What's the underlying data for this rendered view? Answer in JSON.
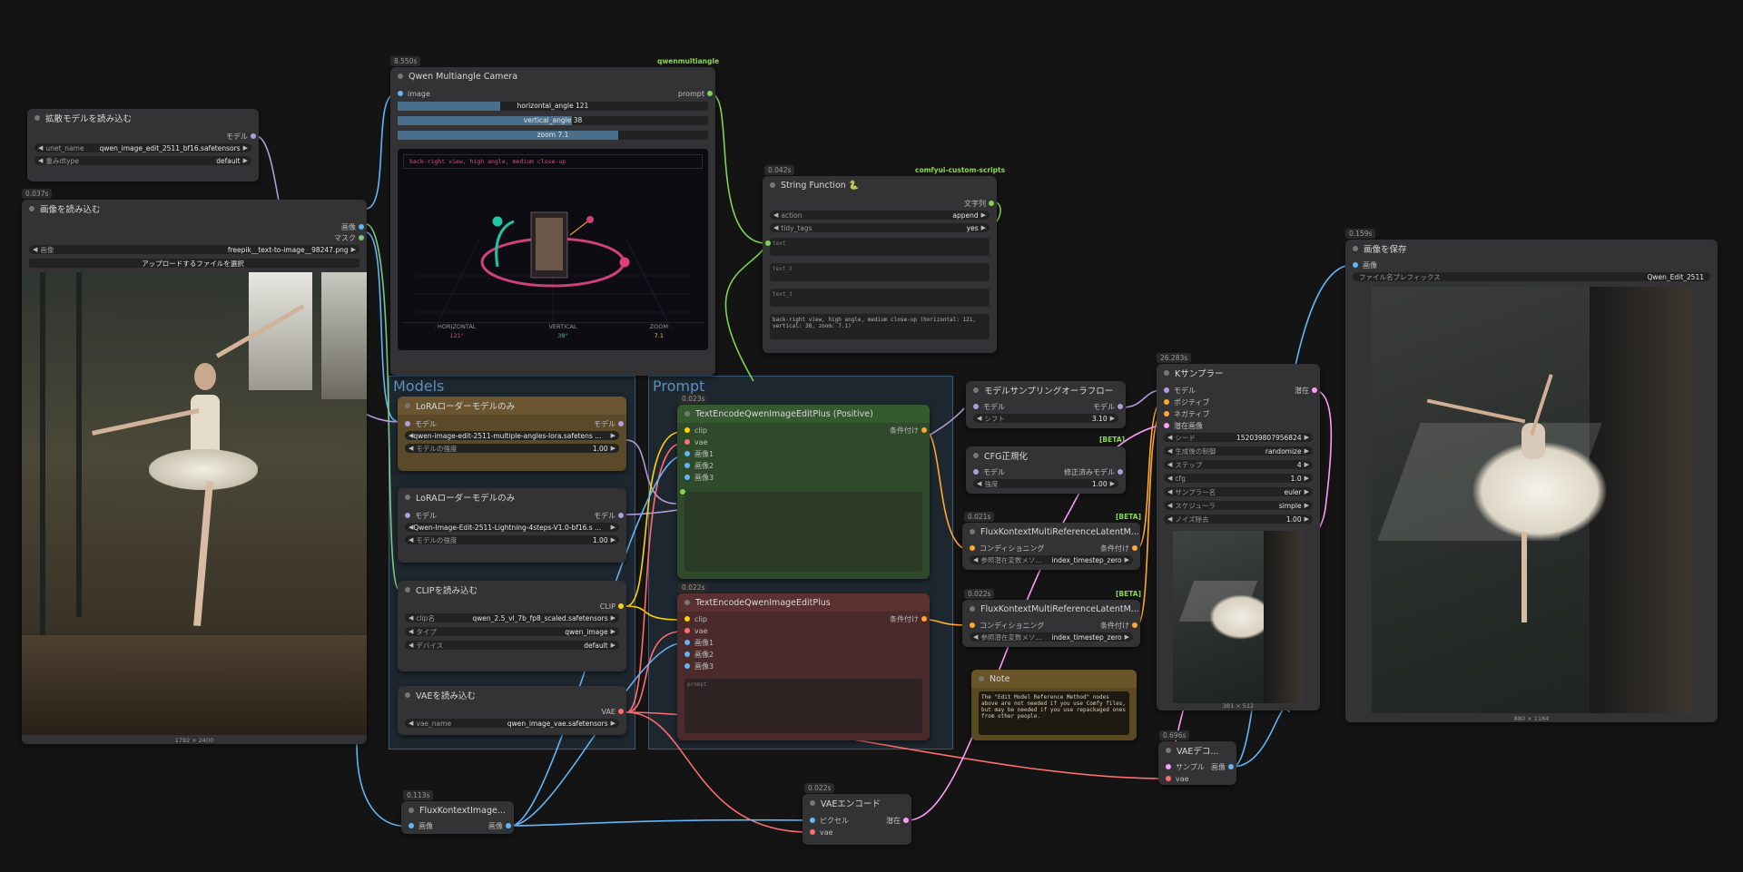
{
  "colors": {
    "image": "#64b5f6",
    "model": "#b39ddb",
    "clip": "#ffd500",
    "vae": "#ff6e6e",
    "cond": "#ffa931",
    "latent": "#ff9cf9",
    "string": "#7fd357",
    "mask": "#81c784"
  },
  "groups": {
    "models": "Models",
    "prompt": "Prompt"
  },
  "n_camera": {
    "time": "8.550s",
    "pack": "qwenmultiangle",
    "title": "Qwen Multiangle Camera",
    "in_image": "image",
    "out_prompt": "prompt",
    "h_label": "horizontal_angle",
    "h_value": "121",
    "h_fraction": 0.33,
    "v_label": "vertical_angle",
    "v_value": "38",
    "v_fraction": 0.56,
    "z_label": "zoom",
    "z_value": "7.1",
    "z_fraction": 0.71,
    "preview_text": "back-right view, high angle, medium close-up",
    "readout_h_label": "HORIZONTAL",
    "readout_h": "121°",
    "readout_v_label": "VERTICAL",
    "readout_v": "38°",
    "readout_z_label": "ZOOM",
    "readout_z": "7.1"
  },
  "n_unet": {
    "title": "拡散モデルを読み込む",
    "out": "モデル",
    "w1_label": "unet_name",
    "w1_value": "qwen_image_edit_2511_bf16.safetensors",
    "w2_label": "重みdtype",
    "w2_value": "default"
  },
  "n_loadimg": {
    "time": "0.037s",
    "title": "画像を読み込む",
    "out1": "画像",
    "out2": "マスク",
    "w1_label": "画像",
    "w1_value": "freepik__text-to-image__98247.png",
    "upload": "アップロードするファイルを選択",
    "dims": "1792 × 2400"
  },
  "n_string": {
    "time": "0.042s",
    "pack": "comfyui-custom-scripts",
    "title": "String Function 🐍",
    "out": "文字列",
    "w1_label": "action",
    "w1_value": "append",
    "w2_label": "tidy_tags",
    "w2_value": "yes",
    "t1": "text",
    "t2": "text_2",
    "t3": "text_3",
    "result": "back-right view, high angle, medium close-up (horizontal: 121, vertical: 38, zoom: 7.1)"
  },
  "n_save": {
    "time": "0.159s",
    "title": "画像を保存",
    "in": "画像",
    "w1_label": "ファイル名プレフィックス",
    "w1_value": "Qwen_Edit_2511",
    "dims": "880 × 1184"
  },
  "n_lora1": {
    "title": "LoRAローダーモデルのみ",
    "in": "モデル",
    "out": "モデル",
    "w1_value": "qwen-image-edit-2511-multiple-angles-lora.safetens ...",
    "w2_label": "モデルの強度",
    "w2_value": "1.00"
  },
  "n_lora2": {
    "title": "LoRAローダーモデルのみ",
    "in": "モデル",
    "out": "モデル",
    "w1_value": "Qwen-Image-Edit-2511-Lightning-4steps-V1.0-bf16.s ...",
    "w2_label": "モデルの強度",
    "w2_value": "1.00"
  },
  "n_clip": {
    "title": "CLIPを読み込む",
    "out": "CLIP",
    "w1_label": "clip名",
    "w1_value": "qwen_2.5_vl_7b_fp8_scaled.safetensors",
    "w2_label": "タイプ",
    "w2_value": "qwen_image",
    "w3_label": "デバイス",
    "w3_value": "default"
  },
  "n_vae": {
    "title": "VAEを読み込む",
    "out": "VAE",
    "w1_label": "vae_name",
    "w1_value": "qwen_image_vae.safetensors"
  },
  "n_pos": {
    "time": "0.023s",
    "title": "TextEncodeQwenImageEditPlus (Positive)",
    "out": "条件付け",
    "i1": "clip",
    "i2": "vae",
    "i3": "画像1",
    "i4": "画像2",
    "i5": "画像3"
  },
  "n_neg": {
    "time": "0.022s",
    "title": "TextEncodeQwenImageEditPlus",
    "out": "条件付け",
    "i1": "clip",
    "i2": "vae",
    "i3": "画像1",
    "i4": "画像2",
    "i5": "画像3",
    "prompt_placeholder": "prompt"
  },
  "n_aura": {
    "title": "モデルサンプリングオーラフロー",
    "in": "モデル",
    "out": "モデル",
    "w1_label": "シフト",
    "w1_value": "3.10"
  },
  "n_cfg": {
    "beta": "[BETA]",
    "title": "CFG正規化",
    "in": "モデル",
    "out": "修正済みモデル",
    "w1_label": "強度",
    "w1_value": "1.00"
  },
  "n_flux1": {
    "time": "0.021s",
    "beta": "[BETA]",
    "title": "FluxKontextMultiReferenceLatentM...",
    "in": "コンディショニング",
    "out": "条件付け",
    "w1_label": "参照潜在変数メソ...",
    "w1_value": "index_timestep_zero"
  },
  "n_flux2": {
    "time": "0.022s",
    "beta": "[BETA]",
    "title": "FluxKontextMultiReferenceLatentM...",
    "in": "コンディショニング",
    "out": "条件付け",
    "w1_label": "参照潜在変数メソ...",
    "w1_value": "index_timestep_zero"
  },
  "n_note": {
    "title": "Note",
    "text": "The \"Edit Model Reference Method\" nodes above are not needed if you use Comfy files, but may be needed if you use repackaged ones from other people."
  },
  "n_ks": {
    "time": "26.283s",
    "title": "Kサンプラー",
    "in1": "モデル",
    "in2": "ポジティブ",
    "in3": "ネガティブ",
    "in4": "潜在画像",
    "out": "潜在",
    "w1_label": "シード",
    "w1_value": "152039807956824",
    "w2_label": "生成後の制御",
    "w2_value": "randomize",
    "w3_label": "ステップ",
    "w3_value": "4",
    "w4_label": "cfg",
    "w4_value": "1.0",
    "w5_label": "サンプラー名",
    "w5_value": "euler",
    "w6_label": "スケジューラ",
    "w6_value": "simple",
    "w7_label": "ノイズ除去",
    "w7_value": "1.00",
    "dims": "381 × 512"
  },
  "n_vaedec": {
    "time": "0.696s",
    "title": "VAEデコ...",
    "in1": "サンプル",
    "in2": "vae",
    "out": "画像"
  },
  "n_vaeenc": {
    "time": "0.022s",
    "title": "VAEエンコード",
    "in1": "ピクセル",
    "in2": "vae",
    "out": "潜在"
  },
  "n_fluxk": {
    "time": "0.113s",
    "title": "FluxKontextImage...",
    "in": "画像",
    "out": "画像"
  }
}
